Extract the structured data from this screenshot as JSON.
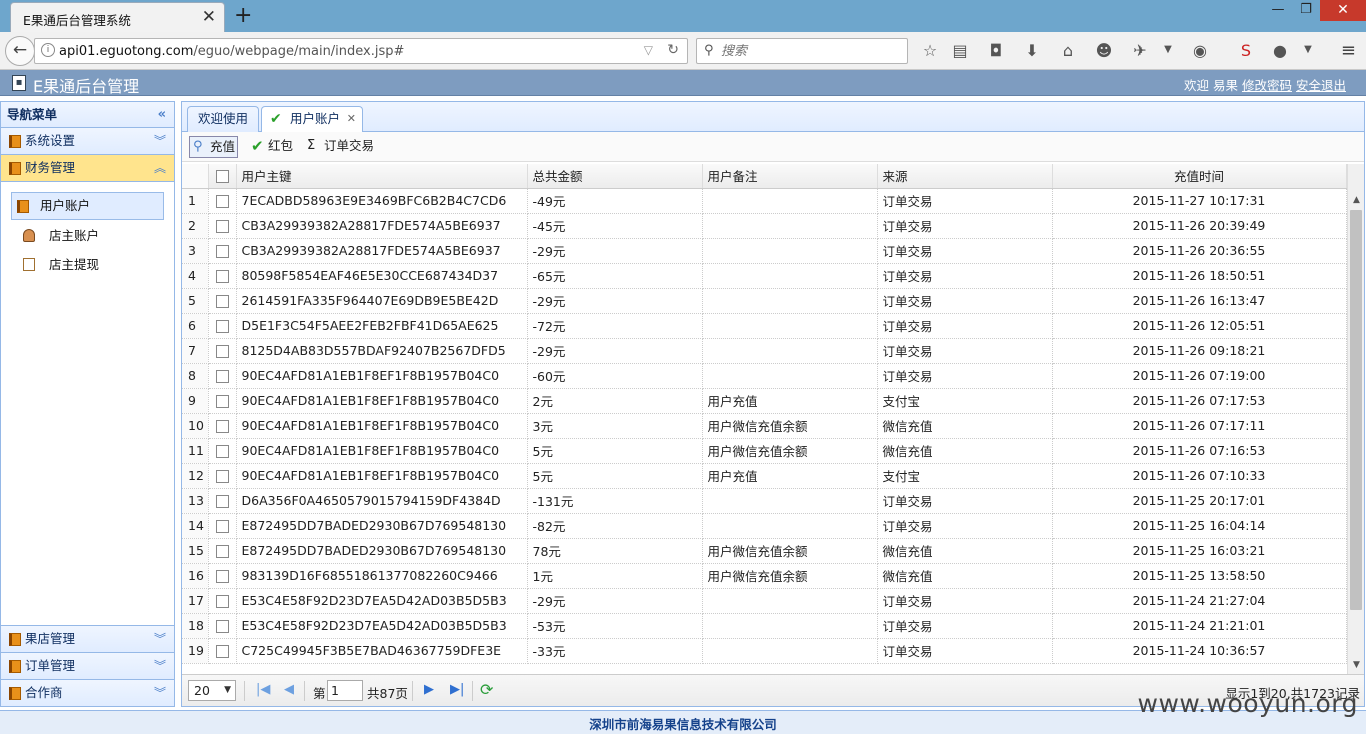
{
  "browser": {
    "tab_title": "E果通后台管理系统",
    "tab_close": "✕",
    "new_tab": "+",
    "url_host": "api01.eguotong.com",
    "url_path": "/eguo/webpage/main/index.jsp#",
    "search_placeholder": "搜索"
  },
  "app": {
    "title": "E果通后台管理",
    "welcome": "欢迎 易果",
    "change_password": "修改密码",
    "logout": "安全退出"
  },
  "sidebar": {
    "title": "导航菜单",
    "groups": [
      {
        "label": "系统设置"
      },
      {
        "label": "财务管理"
      },
      {
        "label": "果店管理"
      },
      {
        "label": "订单管理"
      },
      {
        "label": "合作商"
      }
    ],
    "items": [
      {
        "label": "用户账户"
      },
      {
        "label": "店主账户"
      },
      {
        "label": "店主提现"
      }
    ]
  },
  "main": {
    "tabs": [
      {
        "label": "欢迎使用"
      },
      {
        "label": "用户账户"
      }
    ],
    "toolbar": {
      "recharge": "充值",
      "red_packet": "红包",
      "order_trade": "订单交易"
    },
    "columns": [
      "用户主键",
      "总共金额",
      "用户备注",
      "来源",
      "充值时间"
    ],
    "rows": [
      [
        "1",
        "7ECADBD58963E9E3469BFC6B2B4C7CD6",
        "-49元",
        "",
        "订单交易",
        "2015-11-27 10:17:31"
      ],
      [
        "2",
        "CB3A29939382A28817FDE574A5BE6937",
        "-45元",
        "",
        "订单交易",
        "2015-11-26 20:39:49"
      ],
      [
        "3",
        "CB3A29939382A28817FDE574A5BE6937",
        "-29元",
        "",
        "订单交易",
        "2015-11-26 20:36:55"
      ],
      [
        "4",
        "80598F5854EAF46E5E30CCE687434D37",
        "-65元",
        "",
        "订单交易",
        "2015-11-26 18:50:51"
      ],
      [
        "5",
        "2614591FA335F964407E69DB9E5BE42D",
        "-29元",
        "",
        "订单交易",
        "2015-11-26 16:13:47"
      ],
      [
        "6",
        "D5E1F3C54F5AEE2FEB2FBF41D65AE625",
        "-72元",
        "",
        "订单交易",
        "2015-11-26 12:05:51"
      ],
      [
        "7",
        "8125D4AB83D557BDAF92407B2567DFD5",
        "-29元",
        "",
        "订单交易",
        "2015-11-26 09:18:21"
      ],
      [
        "8",
        "90EC4AFD81A1EB1F8EF1F8B1957B04C0",
        "-60元",
        "",
        "订单交易",
        "2015-11-26 07:19:00"
      ],
      [
        "9",
        "90EC4AFD81A1EB1F8EF1F8B1957B04C0",
        "2元",
        "用户充值",
        "支付宝",
        "2015-11-26 07:17:53"
      ],
      [
        "10",
        "90EC4AFD81A1EB1F8EF1F8B1957B04C0",
        "3元",
        "用户微信充值余额",
        "微信充值",
        "2015-11-26 07:17:11"
      ],
      [
        "11",
        "90EC4AFD81A1EB1F8EF1F8B1957B04C0",
        "5元",
        "用户微信充值余额",
        "微信充值",
        "2015-11-26 07:16:53"
      ],
      [
        "12",
        "90EC4AFD81A1EB1F8EF1F8B1957B04C0",
        "5元",
        "用户充值",
        "支付宝",
        "2015-11-26 07:10:33"
      ],
      [
        "13",
        "D6A356F0A4650579015794159DF4384D",
        "-131元",
        "",
        "订单交易",
        "2015-11-25 20:17:01"
      ],
      [
        "14",
        "E872495DD7BADED2930B67D769548130",
        "-82元",
        "",
        "订单交易",
        "2015-11-25 16:04:14"
      ],
      [
        "15",
        "E872495DD7BADED2930B67D769548130",
        "78元",
        "用户微信充值余额",
        "微信充值",
        "2015-11-25 16:03:21"
      ],
      [
        "16",
        "983139D16F68551861377082260C9466",
        "1元",
        "用户微信充值余额",
        "微信充值",
        "2015-11-25 13:58:50"
      ],
      [
        "17",
        "E53C4E58F92D23D7EA5D42AD03B5D5B3",
        "-29元",
        "",
        "订单交易",
        "2015-11-24 21:27:04"
      ],
      [
        "18",
        "E53C4E58F92D23D7EA5D42AD03B5D5B3",
        "-53元",
        "",
        "订单交易",
        "2015-11-24 21:21:01"
      ],
      [
        "19",
        "C725C49945F3B5E7BAD46367759DFE3E",
        "-33元",
        "",
        "订单交易",
        "2015-11-24 10:36:57"
      ]
    ],
    "pager": {
      "page_size": "20",
      "page_prefix": "第",
      "current_page": "1",
      "total_pages": "共87页",
      "info": "显示1到20,共1723记录"
    }
  },
  "footer": "深圳市前海易果信息技术有限公司",
  "watermark": "www.wooyun.org"
}
